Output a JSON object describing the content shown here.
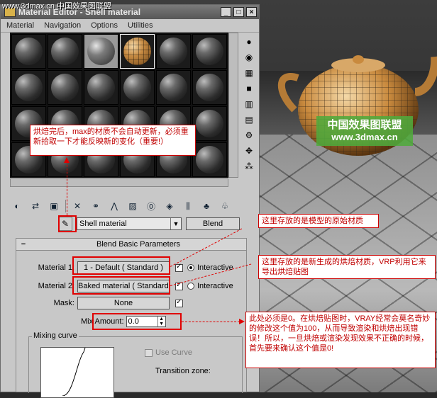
{
  "site_tag": "www.3dmax.cn 中国效果图联盟",
  "window": {
    "title": "Material Editor - Shell material",
    "controls": [
      "_",
      "□",
      "×"
    ]
  },
  "menu": [
    "Material",
    "Navigation",
    "Options",
    "Utilities"
  ],
  "name_row": {
    "material_name": "Shell material",
    "type_button": "Blend"
  },
  "rollout": {
    "title": "Blend Basic Parameters",
    "collapse_symbol": "−",
    "material1": {
      "label": "Material 1:",
      "value": "1 - Default  ( Standard )",
      "enabled": true,
      "interactive_selected": true,
      "interactive_label": "Interactive"
    },
    "material2": {
      "label": "Material 2:",
      "value": "Baked material  ( Standard )",
      "enabled": true,
      "interactive_selected": false,
      "interactive_label": "Interactive"
    },
    "mask": {
      "label": "Mask:",
      "value": "None",
      "enabled": true
    },
    "mix_amount": {
      "label": "Mix Amount:",
      "value": "0.0"
    },
    "mixing_curve": {
      "label": "Mixing curve",
      "use_curve_label": "Use Curve",
      "use_curve_checked": false,
      "transition_label": "Transition zone:"
    }
  },
  "watermark": {
    "line1": "中国效果图联盟",
    "line2": "www.3dmax.cn"
  },
  "annotations": {
    "note_left": "烘焙完后，max的材质不会自动更新，必须重新拾取一下才能反映新的变化（重要!）",
    "note_m1": "这里存放的是模型的原始材质",
    "note_m2": "这里存放的是新生成的烘焙材质，VRP利用它来导出烘焙贴图",
    "note_mix": "此处必须是0。在烘焙贴图时，VRAY经常会莫名奇妙的修改这个值为100，从而导致渲染和烘焙出现错误！所以，一旦烘焙或渲染发现效果不正确的时候，首先要来确认这个值是0!"
  },
  "colors": {
    "annotation": "#e00000",
    "title_bar": "#575757",
    "panel": "#c8c8c8"
  }
}
